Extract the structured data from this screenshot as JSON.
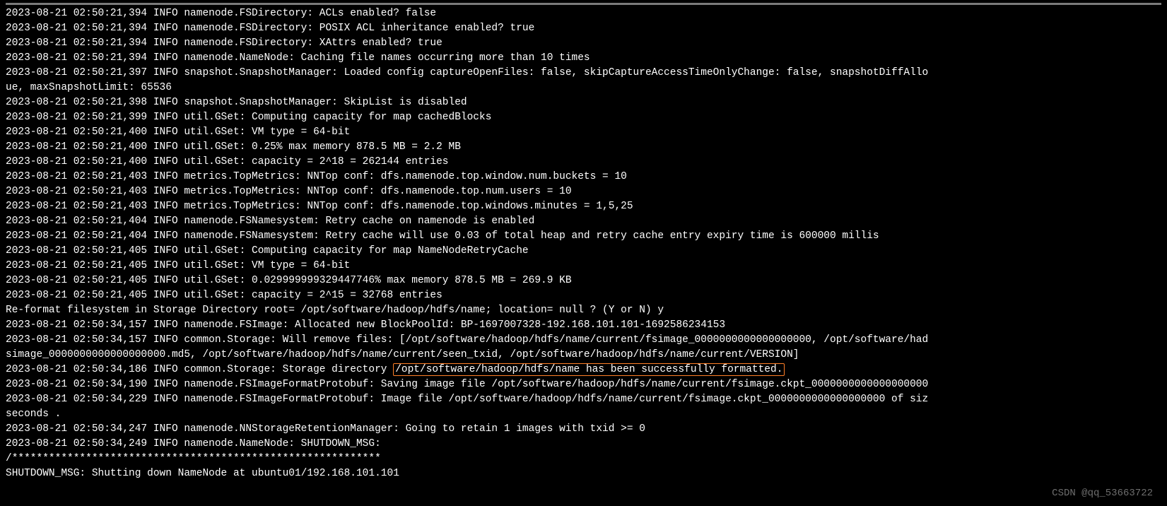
{
  "lines": {
    "l01": "2023-08-21 02:50:21,394 INFO namenode.FSDirectory: ACLs enabled? false",
    "l02": "2023-08-21 02:50:21,394 INFO namenode.FSDirectory: POSIX ACL inheritance enabled? true",
    "l03": "2023-08-21 02:50:21,394 INFO namenode.FSDirectory: XAttrs enabled? true",
    "l04": "2023-08-21 02:50:21,394 INFO namenode.NameNode: Caching file names occurring more than 10 times",
    "l05": "2023-08-21 02:50:21,397 INFO snapshot.SnapshotManager: Loaded config captureOpenFiles: false, skipCaptureAccessTimeOnlyChange: false, snapshotDiffAllo",
    "l06": "ue, maxSnapshotLimit: 65536",
    "l07": "2023-08-21 02:50:21,398 INFO snapshot.SnapshotManager: SkipList is disabled",
    "l08": "2023-08-21 02:50:21,399 INFO util.GSet: Computing capacity for map cachedBlocks",
    "l09": "2023-08-21 02:50:21,400 INFO util.GSet: VM type       = 64-bit",
    "l10": "2023-08-21 02:50:21,400 INFO util.GSet: 0.25% max memory 878.5 MB = 2.2 MB",
    "l11": "2023-08-21 02:50:21,400 INFO util.GSet: capacity      = 2^18 = 262144 entries",
    "l12": "2023-08-21 02:50:21,403 INFO metrics.TopMetrics: NNTop conf: dfs.namenode.top.window.num.buckets = 10",
    "l13": "2023-08-21 02:50:21,403 INFO metrics.TopMetrics: NNTop conf: dfs.namenode.top.num.users = 10",
    "l14": "2023-08-21 02:50:21,403 INFO metrics.TopMetrics: NNTop conf: dfs.namenode.top.windows.minutes = 1,5,25",
    "l15": "2023-08-21 02:50:21,404 INFO namenode.FSNamesystem: Retry cache on namenode is enabled",
    "l16": "2023-08-21 02:50:21,404 INFO namenode.FSNamesystem: Retry cache will use 0.03 of total heap and retry cache entry expiry time is 600000 millis",
    "l17": "2023-08-21 02:50:21,405 INFO util.GSet: Computing capacity for map NameNodeRetryCache",
    "l18": "2023-08-21 02:50:21,405 INFO util.GSet: VM type       = 64-bit",
    "l19": "2023-08-21 02:50:21,405 INFO util.GSet: 0.029999999329447746% max memory 878.5 MB = 269.9 KB",
    "l20": "2023-08-21 02:50:21,405 INFO util.GSet: capacity      = 2^15 = 32768 entries",
    "l21": "Re-format filesystem in Storage Directory root= /opt/software/hadoop/hdfs/name; location= null ? (Y or N) y",
    "l22": "2023-08-21 02:50:34,157 INFO namenode.FSImage: Allocated new BlockPoolId: BP-1697007328-192.168.101.101-1692586234153",
    "l23": "2023-08-21 02:50:34,157 INFO common.Storage: Will remove files: [/opt/software/hadoop/hdfs/name/current/fsimage_0000000000000000000, /opt/software/had",
    "l24": "simage_0000000000000000000.md5, /opt/software/hadoop/hdfs/name/current/seen_txid, /opt/software/hadoop/hdfs/name/current/VERSION]",
    "l25a": "2023-08-21 02:50:34,186 INFO common.Storage: Storage directory ",
    "l25b": "/opt/software/hadoop/hdfs/name has been successfully formatted.",
    "l26": "2023-08-21 02:50:34,190 INFO namenode.FSImageFormatProtobuf: Saving image file /opt/software/hadoop/hdfs/name/current/fsimage.ckpt_0000000000000000000",
    "l27": "2023-08-21 02:50:34,229 INFO namenode.FSImageFormatProtobuf: Image file /opt/software/hadoop/hdfs/name/current/fsimage.ckpt_0000000000000000000 of siz",
    "l28": "seconds .",
    "l29": "2023-08-21 02:50:34,247 INFO namenode.NNStorageRetentionManager: Going to retain 1 images with txid >= 0",
    "l30": "2023-08-21 02:50:34,249 INFO namenode.NameNode: SHUTDOWN_MSG:",
    "l31": "/************************************************************",
    "l32": "SHUTDOWN_MSG: Shutting down NameNode at ubuntu01/192.168.101.101"
  },
  "watermark": "CSDN @qq_53663722"
}
